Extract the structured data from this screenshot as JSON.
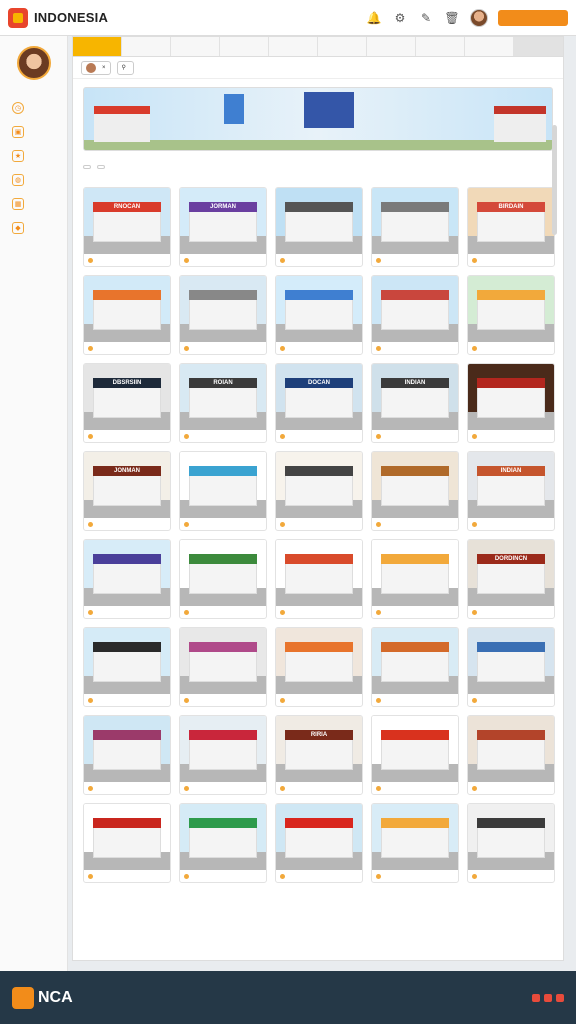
{
  "header": {
    "brand": "INDONESIA",
    "icons": [
      "bell-icon",
      "gear-icon",
      "pen-icon",
      "trash-icon"
    ],
    "cta_label": ""
  },
  "sidebar": {
    "items": [
      {
        "icon": "clock-icon",
        "label": ""
      },
      {
        "icon": "camera-icon",
        "label": ""
      },
      {
        "icon": "star-icon",
        "label": ""
      },
      {
        "icon": "globe-icon",
        "label": ""
      },
      {
        "icon": "grid-icon",
        "label": ""
      },
      {
        "icon": "tag-icon",
        "label": ""
      }
    ]
  },
  "tabs": [
    {
      "label": "",
      "active": true
    },
    {
      "label": ""
    },
    {
      "label": ""
    },
    {
      "label": ""
    },
    {
      "label": ""
    },
    {
      "label": ""
    },
    {
      "label": ""
    },
    {
      "label": ""
    },
    {
      "label": ""
    },
    {
      "label": "",
      "button": true
    }
  ],
  "filter": {
    "chip_label": "",
    "search_label": "",
    "right_items": [
      "",
      ""
    ]
  },
  "banner": {
    "caption": "",
    "left_sign": "",
    "colors": {
      "roof": "#d93b2b",
      "sky": "#c7e4f7"
    }
  },
  "sort": {
    "options": [
      "",
      ""
    ]
  },
  "grid": {
    "rows": [
      {
        "cards": [
          {
            "sign": "RNOCAN",
            "sign_color": "#d93b2b",
            "sky": "#cfe7f6",
            "caption": ""
          },
          {
            "sign": "JORMAN",
            "sign_color": "#6a3fa0",
            "sky": "#d4ebf9",
            "caption": ""
          },
          {
            "sign": "",
            "sign_color": "#555",
            "sky": "#bfe0f4",
            "caption": ""
          },
          {
            "sign": "",
            "sign_color": "#7a7a7a",
            "sky": "#c9e6f7",
            "caption": ""
          },
          {
            "sign": "BIRDAIN",
            "sign_color": "#d4493a",
            "sky": "#f1d9b8",
            "caption": ""
          }
        ]
      },
      {
        "cards": [
          {
            "sign": "",
            "sign_color": "#e8742c",
            "sky": "#d2eaf8",
            "caption": ""
          },
          {
            "sign": "",
            "sign_color": "#888",
            "sky": "#d9e9f3",
            "caption": ""
          },
          {
            "sign": "",
            "sign_color": "#3f7fd1",
            "sky": "#d4ecfa",
            "caption": ""
          },
          {
            "sign": "",
            "sign_color": "#c9463d",
            "sky": "#cce6f6",
            "caption": ""
          },
          {
            "sign": "",
            "sign_color": "#f2a93b",
            "sky": "#d4ecd4",
            "caption": ""
          }
        ]
      },
      {
        "cards": [
          {
            "sign": "DBSRSIIN",
            "sign_color": "#1e2a3a",
            "sky": "#e5e5e5",
            "caption": ""
          },
          {
            "sign": "ROIAN",
            "sign_color": "#3b3b3b",
            "sky": "#d8e9f3",
            "caption": ""
          },
          {
            "sign": "DOCAN",
            "sign_color": "#1e3f7a",
            "sky": "#d1e3ef",
            "caption": ""
          },
          {
            "sign": "INDIAN",
            "sign_color": "#3b3b3b",
            "sky": "#cfe0ea",
            "caption": ""
          },
          {
            "sign": "",
            "sign_color": "#b3261e",
            "sky": "#4a2a1a",
            "caption": ""
          }
        ]
      },
      {
        "cards": [
          {
            "sign": "JONMAN",
            "sign_color": "#7a2a1a",
            "sky": "#f3efe7",
            "caption": ""
          },
          {
            "sign": "",
            "sign_color": "#3aa3d1",
            "sky": "#ffffff",
            "caption": ""
          },
          {
            "sign": "",
            "sign_color": "#444",
            "sky": "#f7f3ec",
            "caption": ""
          },
          {
            "sign": "",
            "sign_color": "#b06a2a",
            "sky": "#efe5d6",
            "caption": ""
          },
          {
            "sign": "INDIAN",
            "sign_color": "#c5552d",
            "sky": "#e4e7eb",
            "caption": ""
          }
        ]
      },
      {
        "cards": [
          {
            "sign": "",
            "sign_color": "#4a3f9a",
            "sky": "#d7ecf8",
            "caption": ""
          },
          {
            "sign": "",
            "sign_color": "#3c8a3c",
            "sky": "#ffffff",
            "caption": ""
          },
          {
            "sign": "",
            "sign_color": "#d94b2b",
            "sky": "#ffffff",
            "caption": ""
          },
          {
            "sign": "",
            "sign_color": "#f2a93b",
            "sky": "#ffffff",
            "caption": ""
          },
          {
            "sign": "DORDINCN",
            "sign_color": "#9b2a1a",
            "sky": "#e7e1d8",
            "caption": ""
          }
        ]
      },
      {
        "cards": [
          {
            "sign": "",
            "sign_color": "#2a2a2a",
            "sky": "#d5ebf7",
            "caption": ""
          },
          {
            "sign": "",
            "sign_color": "#b04a8a",
            "sky": "#e8e8e8",
            "caption": ""
          },
          {
            "sign": "",
            "sign_color": "#e8742c",
            "sky": "#f0e6dc",
            "caption": ""
          },
          {
            "sign": "",
            "sign_color": "#d46a2a",
            "sky": "#d8ebf5",
            "caption": ""
          },
          {
            "sign": "",
            "sign_color": "#3a6fb4",
            "sky": "#d6e4ef",
            "caption": ""
          }
        ]
      },
      {
        "cards": [
          {
            "sign": "",
            "sign_color": "#9b3a6a",
            "sky": "#cfe7f4",
            "caption": ""
          },
          {
            "sign": "",
            "sign_color": "#c9263b",
            "sky": "#e6eef3",
            "caption": ""
          },
          {
            "sign": "RIRIA",
            "sign_color": "#7a2a1a",
            "sky": "#f0ebe4",
            "caption": ""
          },
          {
            "sign": "",
            "sign_color": "#d9321e",
            "sky": "#ffffff",
            "caption": ""
          },
          {
            "sign": "",
            "sign_color": "#b3442a",
            "sky": "#ece3d8",
            "caption": ""
          }
        ]
      },
      {
        "cards": [
          {
            "sign": "",
            "sign_color": "#c9261e",
            "sky": "#ffffff",
            "caption": ""
          },
          {
            "sign": "",
            "sign_color": "#2e9b4b",
            "sky": "#d5ebf6",
            "caption": ""
          },
          {
            "sign": "",
            "sign_color": "#d9261e",
            "sky": "#cfe7f4",
            "caption": ""
          },
          {
            "sign": "",
            "sign_color": "#f2a93b",
            "sky": "#d8ecf7",
            "caption": ""
          },
          {
            "sign": "",
            "sign_color": "#3b3b3b",
            "sky": "#f0f0f0",
            "caption": ""
          }
        ]
      }
    ]
  },
  "footer": {
    "brand": "NCA",
    "columns": [
      [
        "",
        "",
        ""
      ],
      [
        "",
        "",
        ""
      ],
      [
        "",
        "",
        ""
      ],
      [
        "",
        "",
        ""
      ]
    ]
  }
}
